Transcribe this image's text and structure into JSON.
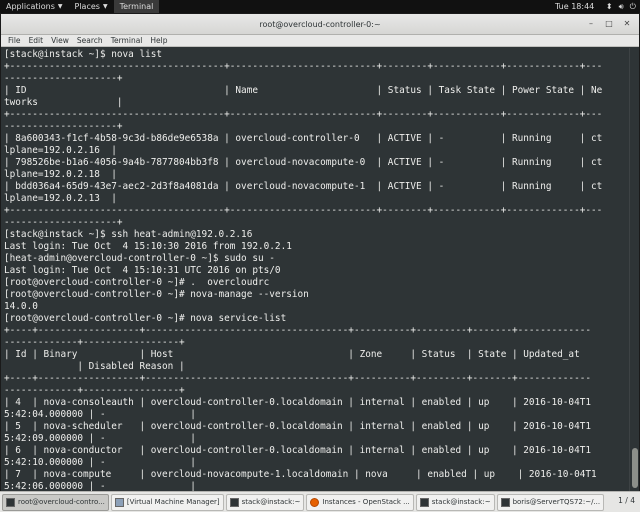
{
  "top_panel": {
    "applications": "Applications",
    "places": "Places",
    "terminal": "Terminal",
    "clock": "Tue 18:44",
    "tray_icons": [
      "network-icon",
      "volume-icon",
      "power-icon"
    ]
  },
  "window": {
    "title": "root@overcloud-controller-0:~",
    "menu": [
      "File",
      "Edit",
      "View",
      "Search",
      "Terminal",
      "Help"
    ]
  },
  "terminal_lines": [
    "[stack@instack ~]$ nova list",
    "+--------------------------------------+--------------------------+--------+------------+-------------+---",
    "--------------------+",
    "| ID                                   | Name                     | Status | Task State | Power State | Ne",
    "tworks              |",
    "+--------------------------------------+--------------------------+--------+------------+-------------+---",
    "--------------------+",
    "| 8a600343-f1cf-4b58-9c3d-b86de9e6538a | overcloud-controller-0   | ACTIVE | -          | Running     | ct",
    "lplane=192.0.2.16  |",
    "| 798526be-b1a6-4056-9a4b-7877804bb3f8 | overcloud-novacompute-0  | ACTIVE | -          | Running     | ct",
    "lplane=192.0.2.18  |",
    "| bdd036a4-65d9-43e7-aec2-2d3f8a4081da | overcloud-novacompute-1  | ACTIVE | -          | Running     | ct",
    "lplane=192.0.2.13  |",
    "+--------------------------------------+--------------------------+--------+------------+-------------+---",
    "--------------------+",
    "[stack@instack ~]$ ssh heat-admin@192.0.2.16",
    "Last login: Tue Oct  4 15:10:30 2016 from 192.0.2.1",
    "[heat-admin@overcloud-controller-0 ~]$ sudo su -",
    "Last login: Tue Oct  4 15:10:31 UTC 2016 on pts/0",
    "[root@overcloud-controller-0 ~]# .  overcloudrc",
    "[root@overcloud-controller-0 ~]# nova-manage --version",
    "14.0.0",
    "[root@overcloud-controller-0 ~]# nova service-list",
    "+----+------------------+------------------------------------+----------+---------+-------+-------------",
    "-------------+-----------------+",
    "| Id | Binary           | Host                               | Zone     | Status  | State | Updated_at",
    "             | Disabled Reason |",
    "+----+------------------+------------------------------------+----------+---------+-------+-------------",
    "-------------+-----------------+",
    "| 4  | nova-consoleauth | overcloud-controller-0.localdomain | internal | enabled | up    | 2016-10-04T1",
    "5:42:04.000000 | -               |",
    "| 5  | nova-scheduler   | overcloud-controller-0.localdomain | internal | enabled | up    | 2016-10-04T1",
    "5:42:09.000000 | -               |",
    "| 6  | nova-conductor   | overcloud-controller-0.localdomain | internal | enabled | up    | 2016-10-04T1",
    "5:42:10.000000 | -               |",
    "| 7  | nova-compute     | overcloud-novacompute-1.localdomain | nova     | enabled | up    | 2016-10-04T1",
    "5:42:06.000000 | -               |"
  ],
  "taskbar": {
    "tasks": [
      {
        "label": "root@overcloud-contro...",
        "icon": "terminal-icon",
        "active": true
      },
      {
        "label": "[Virtual Machine Manager]",
        "icon": "vm-icon",
        "active": false
      },
      {
        "label": "stack@instack:~",
        "icon": "terminal-icon",
        "active": false
      },
      {
        "label": "Instances - OpenStack ...",
        "icon": "firefox-icon",
        "active": false
      },
      {
        "label": "stack@instack:~",
        "icon": "terminal-icon",
        "active": false
      },
      {
        "label": "boris@ServerTQS72:~/...",
        "icon": "terminal-icon",
        "active": false
      }
    ],
    "pager": "1 / 4"
  }
}
